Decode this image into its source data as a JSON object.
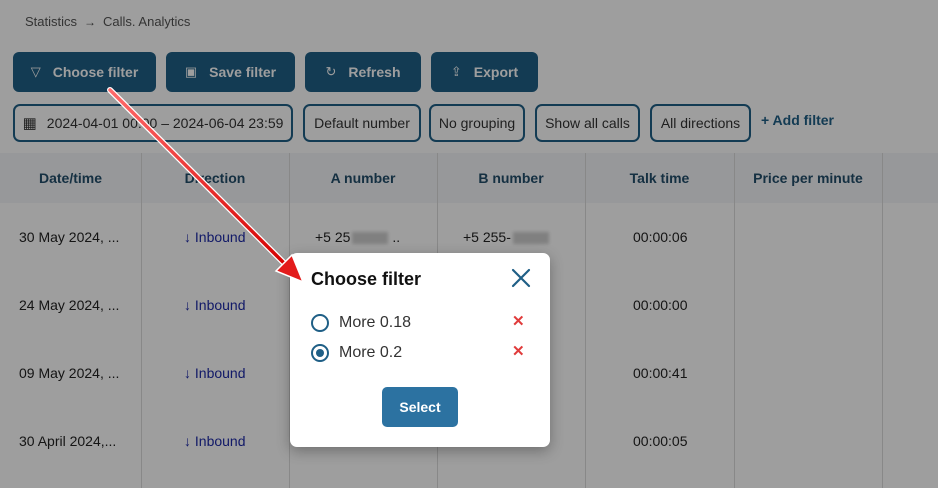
{
  "breadcrumb": {
    "items": [
      "Statistics",
      "Calls. Analytics"
    ],
    "separator": "→"
  },
  "toolbar": {
    "choose_filter": "Choose filter",
    "save_filter": "Save filter",
    "refresh": "Refresh",
    "export": "Export"
  },
  "filters": {
    "date_range": "2024-04-01 00:00 – 2024-06-04 23:59",
    "number": "Default number",
    "grouping": "No grouping",
    "calls": "Show all calls",
    "directions": "All directions",
    "add_filter": "+ Add filter"
  },
  "table": {
    "headers": [
      "Date/time",
      "Direction",
      "A number",
      "B number",
      "Talk time",
      "Price per minute"
    ],
    "rows": [
      {
        "date": "30 May 2024, ...",
        "direction": "↓ Inbound",
        "a_number": "+5 25",
        "b_number": "+5 255-",
        "talk_time": "00:00:06"
      },
      {
        "date": "24 May 2024, ...",
        "direction": "↓ Inbound",
        "a_number": "",
        "b_number": "",
        "talk_time": "00:00:00"
      },
      {
        "date": "09 May 2024, ...",
        "direction": "↓ Inbound",
        "a_number": "",
        "b_number": "",
        "talk_time": "00:00:41"
      },
      {
        "date": "30 April 2024,...",
        "direction": "↓ Inbound",
        "a_number": "",
        "b_number": "",
        "talk_time": "00:00:05"
      }
    ]
  },
  "modal": {
    "title": "Choose filter",
    "options": [
      {
        "label": "More 0.18",
        "selected": false
      },
      {
        "label": "More 0.2",
        "selected": true
      }
    ],
    "select_label": "Select"
  },
  "icons": {
    "choose_filter": "filter-icon",
    "save_filter": "save-icon",
    "refresh": "refresh-icon",
    "export": "export-icon",
    "date_range": "calendar-icon",
    "close": "close-icon",
    "delete": "delete-icon"
  },
  "colors": {
    "primary": "#1f5f86",
    "select_button": "#2c72a1",
    "inbound": "#1e2aa8",
    "delete": "#e03b3b",
    "annotation_arrow": "#e31b1b"
  }
}
